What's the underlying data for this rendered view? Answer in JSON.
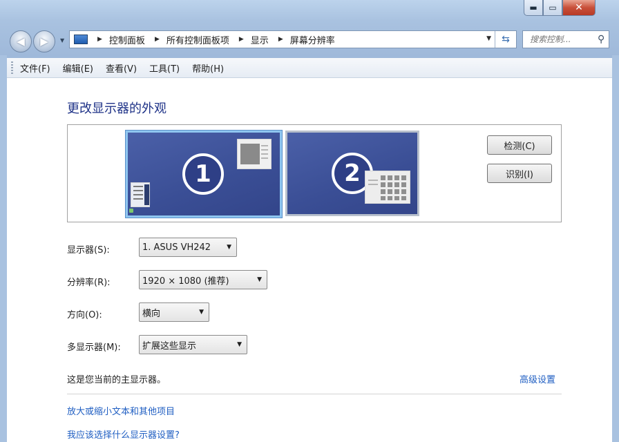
{
  "window": {
    "caption": {
      "minimize": "▬",
      "maximize": "▭",
      "close": "✕"
    }
  },
  "nav": {
    "back_icon": "arrow-left-icon",
    "forward_icon": "arrow-right-icon",
    "breadcrumb": [
      "控制面板",
      "所有控制面板项",
      "显示",
      "屏幕分辨率"
    ],
    "search_placeholder": "搜索控制..."
  },
  "menu": [
    "文件(F)",
    "编辑(E)",
    "查看(V)",
    "工具(T)",
    "帮助(H)"
  ],
  "main": {
    "title": "更改显示器的外观",
    "monitors": [
      {
        "number": "1",
        "selected": true
      },
      {
        "number": "2",
        "selected": false
      }
    ],
    "detect_button": "检测(C)",
    "identify_button": "识别(I)",
    "fields": {
      "display": {
        "label": "显示器(S):",
        "value": "1. ASUS VH242"
      },
      "resolution": {
        "label": "分辨率(R):",
        "value": "1920 × 1080 (推荐)"
      },
      "orientation": {
        "label": "方向(O):",
        "value": "横向"
      },
      "multi": {
        "label": "多显示器(M):",
        "value": "扩展这些显示"
      }
    },
    "primary_note": "这是您当前的主显示器。",
    "advanced_link": "高级设置",
    "links": [
      "放大或缩小文本和其他项目",
      "我应该选择什么显示器设置?"
    ]
  },
  "colors": {
    "accent": "#1f5ec2",
    "title": "#1e3287",
    "monitor": "#3a4e95"
  }
}
